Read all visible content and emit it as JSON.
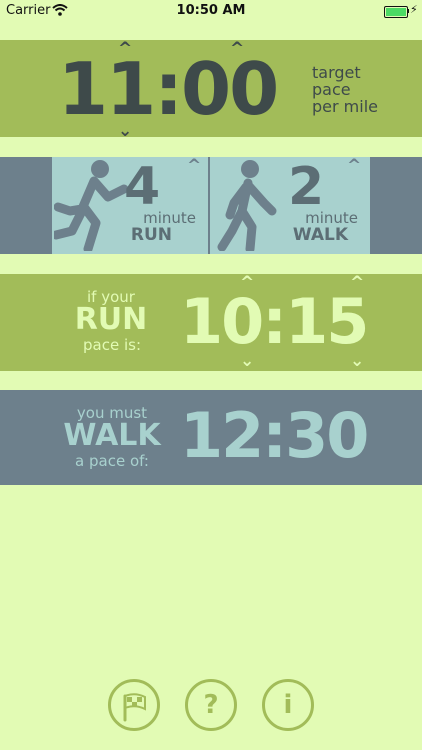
{
  "status_bar": {
    "carrier": "Carrier",
    "time": "10:50 AM"
  },
  "target": {
    "time": "11:00",
    "label_line1": "target",
    "label_line2": "pace",
    "label_line3": "per mile"
  },
  "intervals": {
    "run_minutes": "4",
    "run_unit": "minute",
    "run_label": "RUN",
    "walk_minutes": "2",
    "walk_unit": "minute",
    "walk_label": "WALK"
  },
  "run_pace": {
    "prefix": "if your",
    "word": "RUN",
    "suffix": "pace is:",
    "time": "10:15"
  },
  "walk_pace": {
    "prefix": "you must",
    "word": "WALK",
    "suffix": "a pace of:",
    "time": "12:30"
  },
  "footer_buttons": {
    "help": "?",
    "info": "i"
  },
  "colors": {
    "background": "#e2fbb4",
    "green_band": "#a2bc59",
    "slate_band": "#6d808c",
    "tile": "#a8d1ce",
    "dark_text": "#3e4a4a"
  }
}
